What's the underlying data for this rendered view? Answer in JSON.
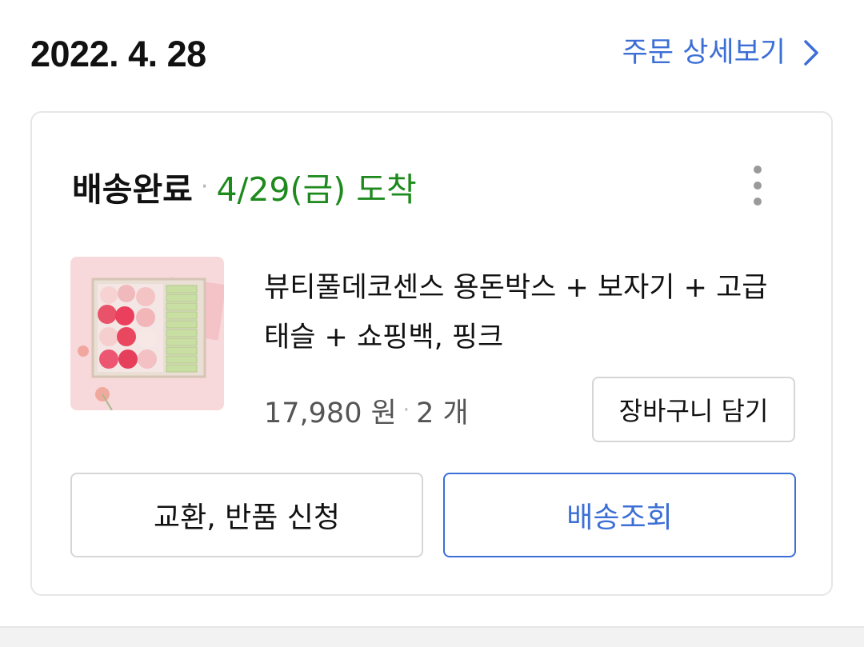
{
  "order": {
    "date": "2022. 4. 28",
    "detail_link_label": "주문 상세보기"
  },
  "delivery": {
    "status": "배송완료",
    "separator": "·",
    "arrival": "4/29(금) 도착"
  },
  "product": {
    "name": "뷰티풀데코센스 용돈박스 + 보자기 + 고급 태슬 + 쇼핑백, 핑크",
    "price": "17,980 원",
    "separator": "·",
    "quantity": "2 개"
  },
  "buttons": {
    "cart": "장바구니 담기",
    "return": "교환, 반품 신청",
    "tracking": "배송조회"
  },
  "icons": {
    "detail_link": "chevron-right-icon",
    "more": "more-vertical-icon"
  },
  "colors": {
    "accent_blue": "#3c6fd6",
    "status_green": "#1e8a1e",
    "text_primary": "#111111",
    "text_secondary": "#555555",
    "border": "#d6d6d6"
  }
}
